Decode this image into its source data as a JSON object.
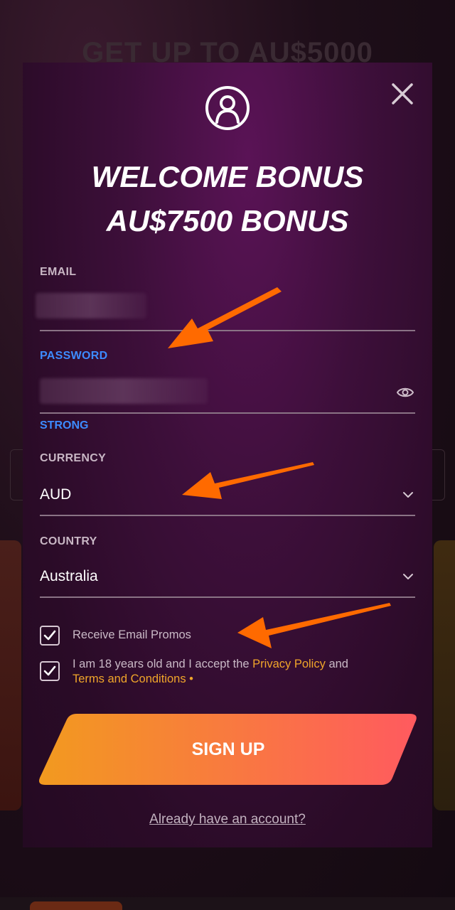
{
  "background": {
    "headline": "GET UP TO AU$5000"
  },
  "modal": {
    "title_line1": "WELCOME BONUS",
    "title_line2": "AU$7500 BONUS",
    "close_icon": "close-icon",
    "avatar_icon": "user-circle-icon"
  },
  "form": {
    "email": {
      "label": "EMAIL",
      "value": ""
    },
    "password": {
      "label": "PASSWORD",
      "value": "",
      "strength": "STRONG",
      "toggle_icon": "eye-icon"
    },
    "currency": {
      "label": "CURRENCY",
      "value": "AUD"
    },
    "country": {
      "label": "COUNTRY",
      "value": "Australia"
    }
  },
  "checkboxes": {
    "promos": {
      "label": "Receive Email Promos",
      "checked": true
    },
    "terms": {
      "prefix": "I am 18 years old and I accept the ",
      "privacy": "Privacy Policy",
      "and": " and",
      "terms": "Terms and Conditions",
      "required": " •",
      "checked": true
    }
  },
  "actions": {
    "signup": "SIGN UP",
    "login": "Already have an account?"
  },
  "colors": {
    "accent_blue": "#3d8bff",
    "link_yellow": "#f0a52a",
    "button_start": "#f29a1f",
    "button_end": "#ff5a5f",
    "arrow_orange": "#ff6a00"
  }
}
